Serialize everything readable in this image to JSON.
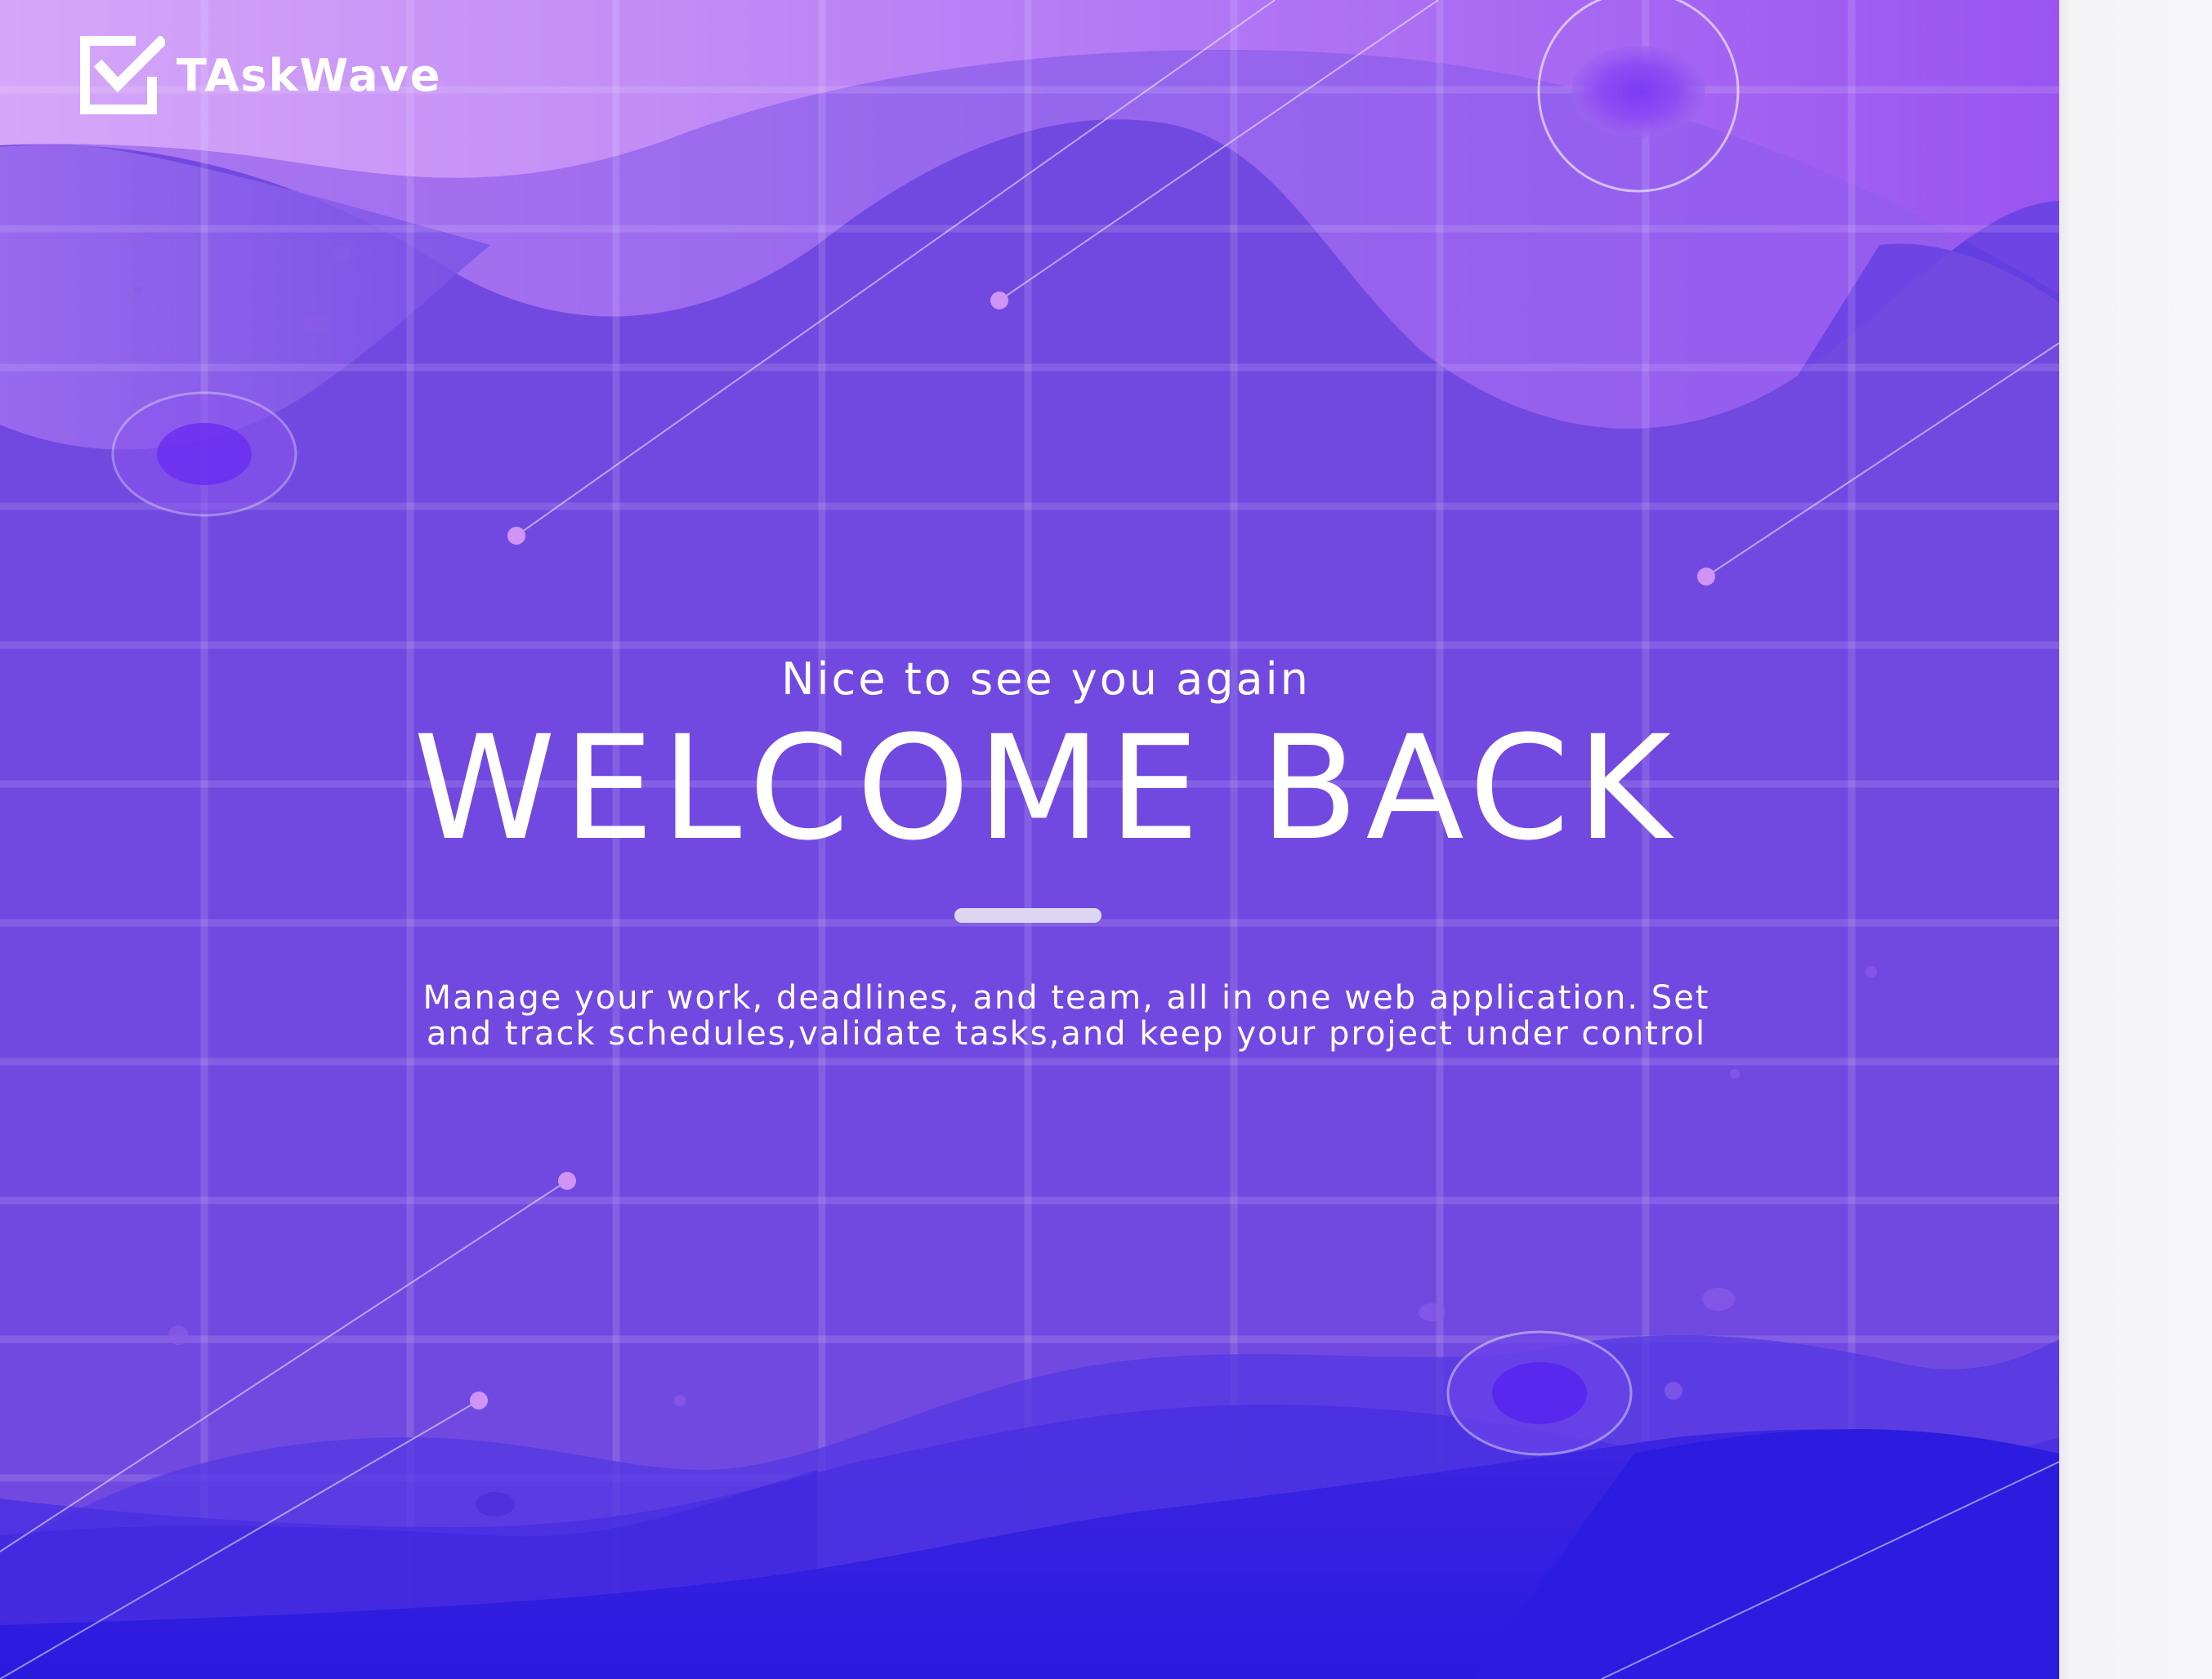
{
  "brand": {
    "name": "TAskWave",
    "icon": "checkbox-check-icon"
  },
  "hero": {
    "greeting": "Nice to see you again",
    "headline": "WELCOME BACK",
    "description": "Manage your work, deadlines, and team, all in one web application. Set and track schedules,validate tasks,and keep your project under control"
  },
  "colors": {
    "background": "#7249e0",
    "wave_light": "#c894f6",
    "wave_deep": "#2c1cdf",
    "text": "#ffffff",
    "divider": "#dcd6f3",
    "side_panel": "#f4f4f7"
  }
}
